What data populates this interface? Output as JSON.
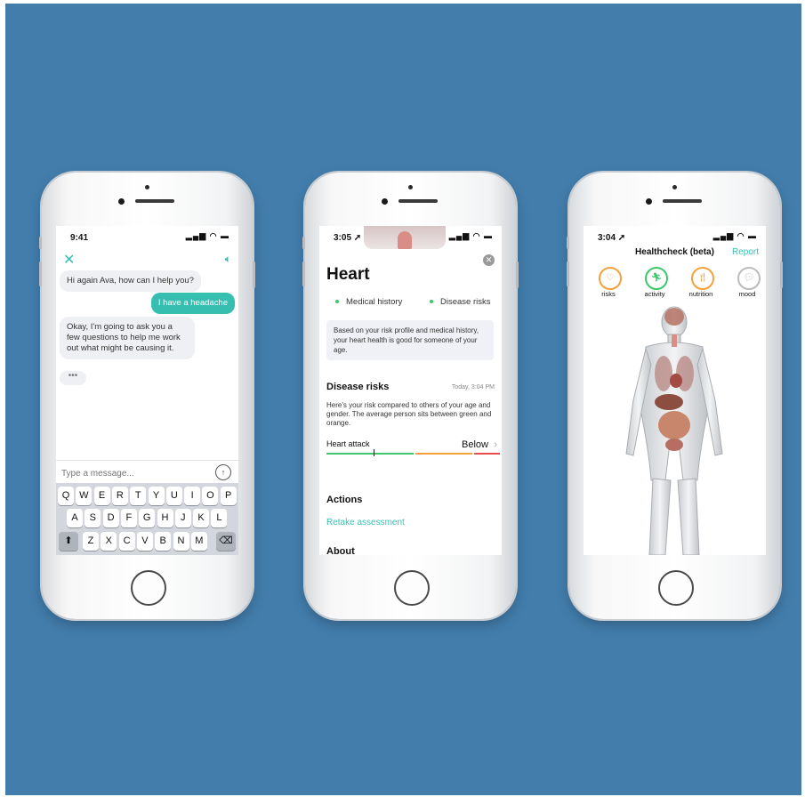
{
  "colors": {
    "background": "#427dac",
    "accent": "#36bfb1",
    "green": "#3cc76a",
    "orange": "#f5a03a",
    "red": "#e84a4a"
  },
  "phone1": {
    "status": {
      "time": "9:41",
      "icons": "signal-wifi-battery"
    },
    "header": {
      "close_icon": "close-icon",
      "speaker_icon": "speaker-icon"
    },
    "messages": [
      {
        "from": "bot",
        "text": "Hi again Ava, how can I help you?"
      },
      {
        "from": "user",
        "text": "I have a headache"
      },
      {
        "from": "bot",
        "text": "Okay, I'm going to ask you a few questions to help me work out what might be causing it."
      }
    ],
    "typing": "•••",
    "input": {
      "placeholder": "Type a message...",
      "value": ""
    },
    "keyboard": {
      "row1": [
        "Q",
        "W",
        "E",
        "R",
        "T",
        "Y",
        "U",
        "I",
        "O",
        "P"
      ],
      "row2": [
        "A",
        "S",
        "D",
        "F",
        "G",
        "H",
        "J",
        "K",
        "L"
      ],
      "row3": [
        "Z",
        "X",
        "C",
        "V",
        "B",
        "N",
        "M"
      ]
    }
  },
  "phone2": {
    "status": {
      "time": "3:05 ➚"
    },
    "title": "Heart",
    "tabs": [
      "Medical history",
      "Disease risks"
    ],
    "summary": "Based on your risk profile and medical history, your heart health is good for someone of your age.",
    "disease_risks": {
      "title": "Disease risks",
      "date": "Today, 3:04 PM",
      "description": "Here's your risk compared to others of your age and gender. The average person sits between green and orange.",
      "item": {
        "label": "Heart attack",
        "value": "Below",
        "level": 0.27
      }
    },
    "actions": {
      "title": "Actions",
      "link": "Retake assessment"
    },
    "about": {
      "title": "About"
    }
  },
  "phone3": {
    "status": {
      "time": "3:04 ➚"
    },
    "title": "Healthcheck (beta)",
    "report": "Report",
    "categories": [
      {
        "label": "risks",
        "icon": "heart-outline-icon",
        "color": "#f5a03a"
      },
      {
        "label": "activity",
        "icon": "running-icon",
        "color": "#3cc76a"
      },
      {
        "label": "nutrition",
        "icon": "cutlery-icon",
        "color": "#f5a03a"
      },
      {
        "label": "mood",
        "icon": "speech-bubble-icon",
        "color": "#bbbbbb"
      }
    ]
  }
}
